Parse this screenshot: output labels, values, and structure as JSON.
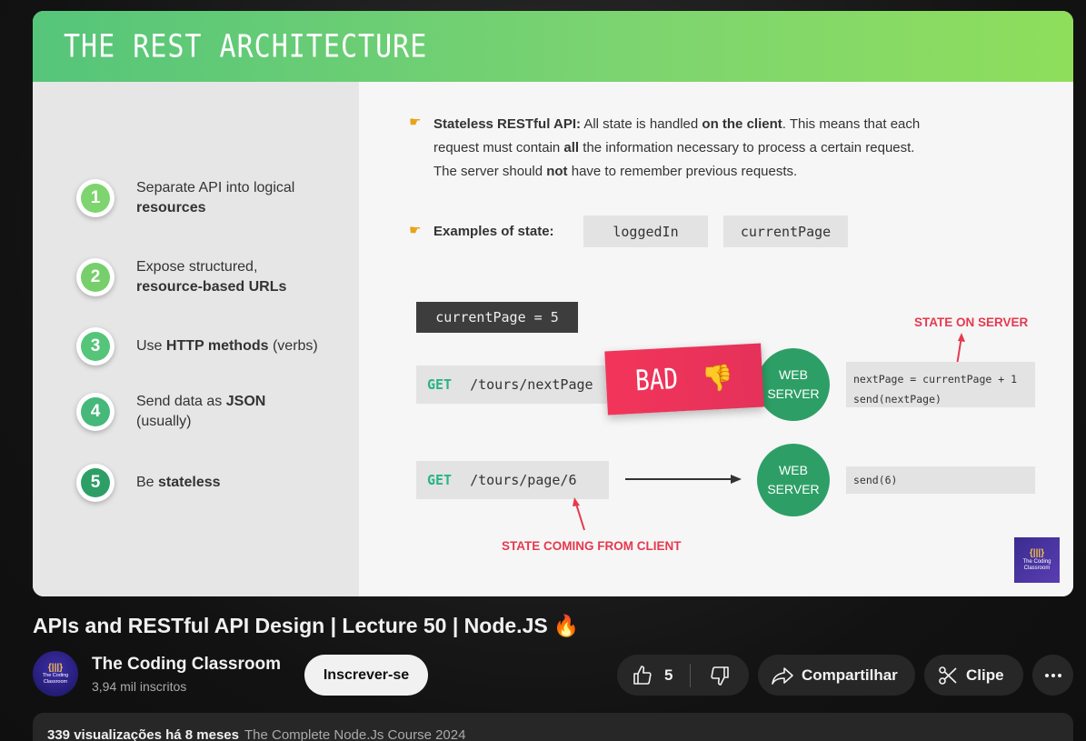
{
  "slide": {
    "title": "THE REST ARCHITECTURE",
    "points": [
      {
        "num": "1",
        "text_a": "Separate API into logical",
        "text_b": "resources",
        "color": "#7ed56f"
      },
      {
        "num": "2",
        "text_a": "Expose structured,",
        "text_b": "resource-based URLs",
        "color": "#76cf6b"
      },
      {
        "num": "3",
        "text_a": "Use ",
        "bold": "HTTP methods",
        "text_b": " (verbs)",
        "color": "#55c57a"
      },
      {
        "num": "4",
        "text_a": "Send data as ",
        "bold": "JSON",
        "text_b": "(usually)",
        "color": "#45b87a"
      },
      {
        "num": "5",
        "text_a": "Be ",
        "bold": "stateless",
        "color": "#2d9f66"
      }
    ],
    "stateless": {
      "label": "Stateless RESTful API:",
      "line1_a": " All state is handled ",
      "line1_b": "on the client",
      "line1_c": ". This means that each",
      "line2_a": "request must contain ",
      "line2_b": "all",
      "line2_c": " the information necessary to process a certain request.",
      "line3_a": "The server should ",
      "line3_b": "not",
      "line3_c": " have to remember previous requests."
    },
    "examples_label": "Examples of state:",
    "examples": [
      "loggedIn",
      "currentPage"
    ],
    "current_page_box": "currentPage = 5",
    "state_on_server": "STATE ON SERVER",
    "req1": {
      "method": "GET",
      "path": "/tours/nextPage"
    },
    "req2": {
      "method": "GET",
      "path": "/tours/page/6"
    },
    "bad_label": "BAD",
    "server_label_1": "WEB",
    "server_label_2": "SERVER",
    "server_code_1a": "nextPage = currentPage + 1",
    "server_code_1b": "send(nextPage)",
    "server_code_2": "send(6)",
    "state_from_client": "STATE COMING FROM CLIENT",
    "watermark_line1": "The Coding",
    "watermark_line2": "Classroom"
  },
  "video": {
    "title": "APIs and RESTful API Design | Lecture 50 | Node.JS",
    "title_emoji": "🔥"
  },
  "channel": {
    "name": "The Coding Classroom",
    "subscribers": "3,94 mil inscritos",
    "avatar_line1": "The Coding",
    "avatar_line2": "Classroom"
  },
  "actions": {
    "subscribe": "Inscrever-se",
    "likes": "5",
    "share": "Compartilhar",
    "clip": "Clipe"
  },
  "description": {
    "views": "339 visualizações  há 8 meses",
    "playlist": "The Complete Node.Js Course 2024"
  }
}
